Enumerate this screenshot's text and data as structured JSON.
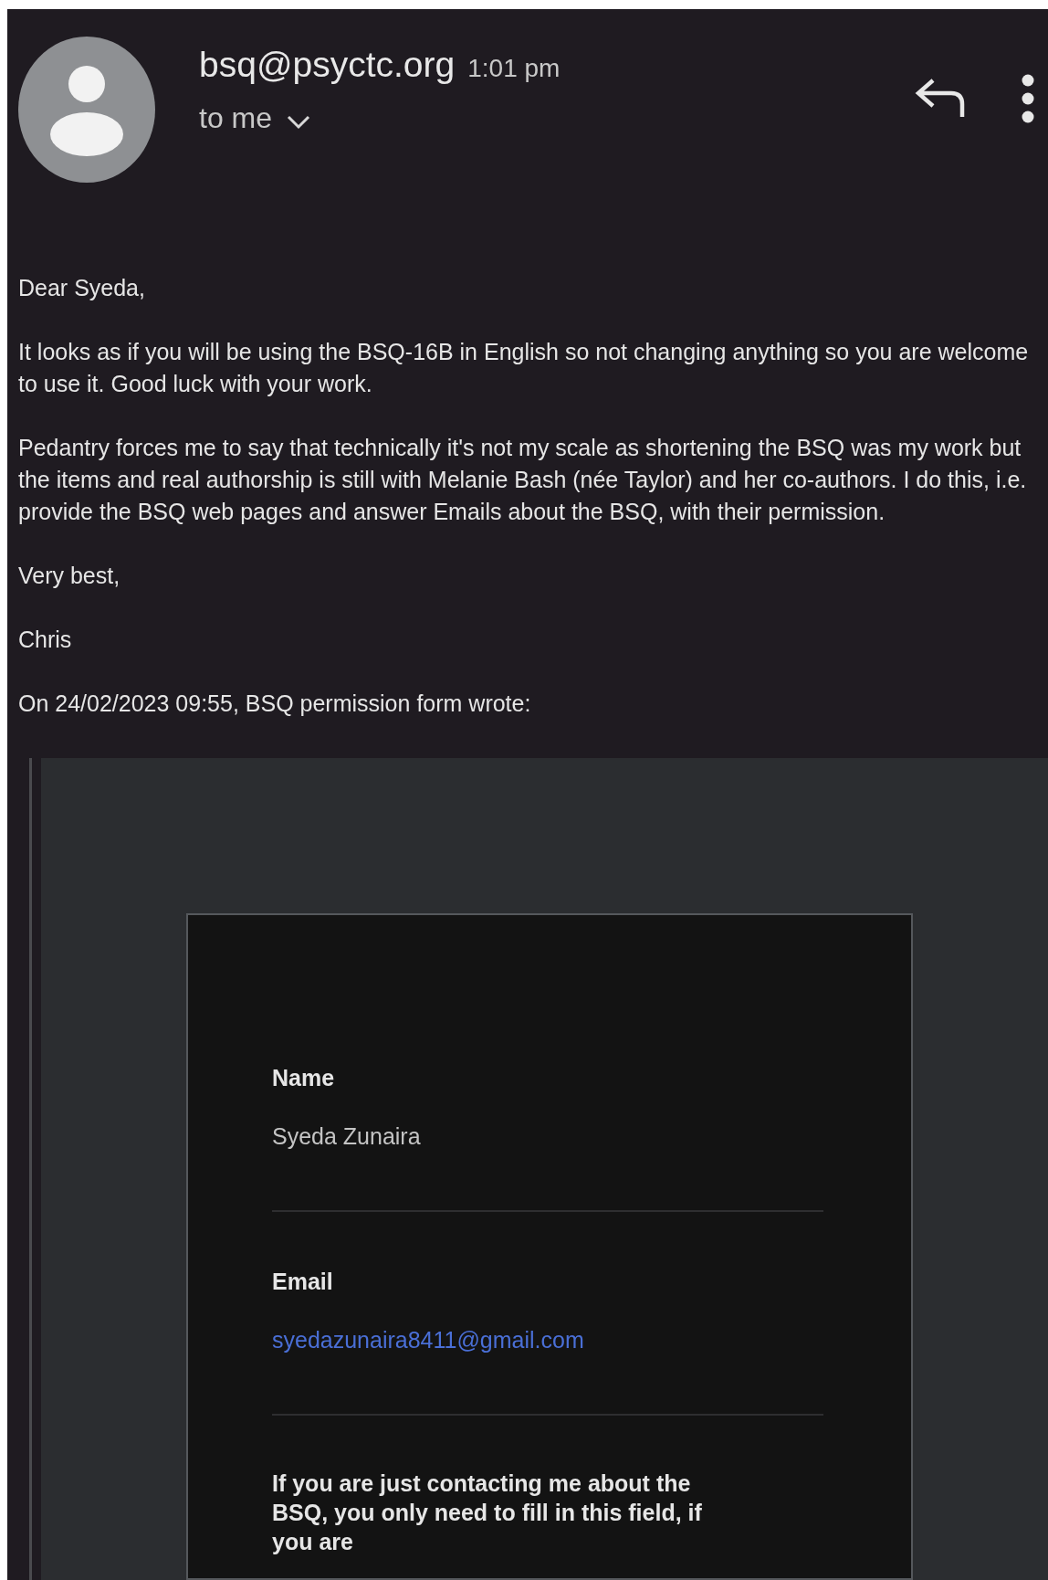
{
  "header": {
    "sender": "bsq@psyctc.org",
    "time": "1:01 pm",
    "recipient": "to me"
  },
  "body": [
    "Dear Syeda,",
    "It looks as if you will be using the BSQ-16B in English so not changing anything so you are welcome to use it.  Good luck with your work.",
    "Pedantry forces me to say that technically it's not my scale as shortening the BSQ was my work but the items and real authorship is still with Melanie Bash (née Taylor) and her co-authors.  I do this, i.e. provide the BSQ web pages and answer Emails about the BSQ, with their permission.",
    "Very best,",
    "Chris",
    "On 24/02/2023 09:55, BSQ permission form wrote:"
  ],
  "quoted_form": {
    "fields": [
      {
        "label": "Name",
        "value": "Syeda Zunaira",
        "kind": "text"
      },
      {
        "label": "Email",
        "value": "syedazunaira8411@gmail.com",
        "kind": "link"
      }
    ],
    "note": "If you are just contacting me about the BSQ, you only need to fill in this field, if you are"
  }
}
